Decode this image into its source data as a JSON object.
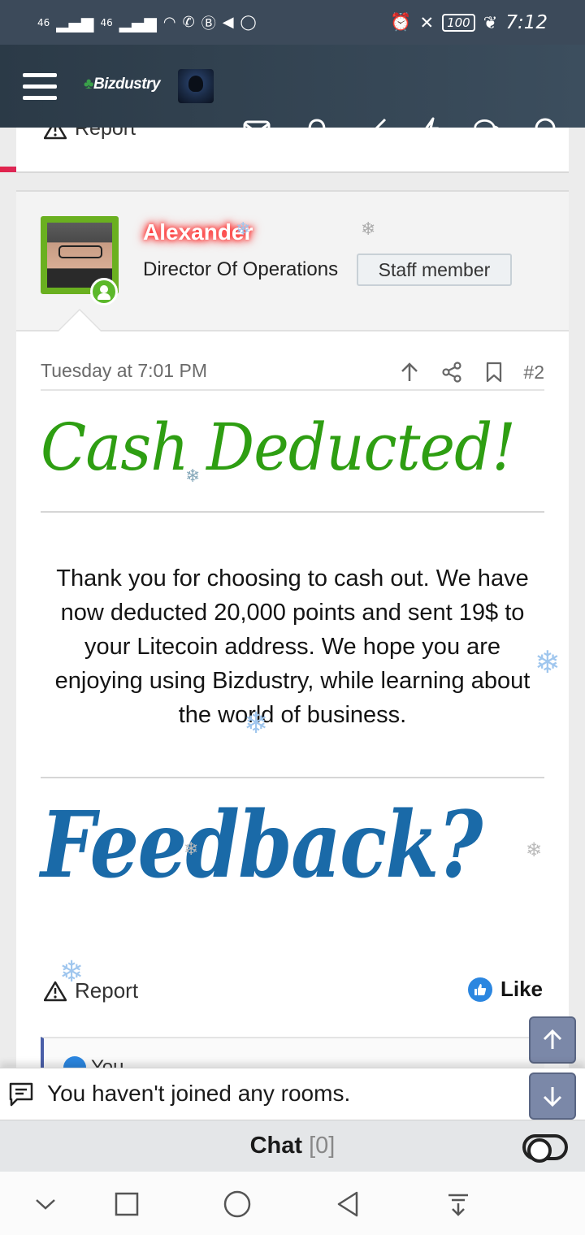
{
  "status_bar": {
    "signal_left": "46",
    "signal_right": "46",
    "battery": "100",
    "time": "7:12"
  },
  "app_bar": {
    "logo_text": "Bizdustry"
  },
  "previous_post": {
    "report_label": "Report"
  },
  "post": {
    "author": "Alexander",
    "user_title": "Director Of Operations",
    "badge": "Staff member",
    "date": "Tuesday at 7:01 PM",
    "number": "#2",
    "heading_image_text": "Cash Deducted!",
    "body": "Thank you for choosing to cash out. We have now deducted 20,000 points and sent 19$ to your Litecoin address. We hope you are enjoying using Bizdustry, while learning about the world of business.",
    "feedback_image_text": "Feedback?",
    "report_label": "Report",
    "like_label": "Like",
    "reaction_preview": "You"
  },
  "chat": {
    "message": "You haven't joined any rooms.",
    "label": "Chat",
    "count": "[0]"
  },
  "colors": {
    "appbar": "#2b3a47",
    "username_glow": "#ff2a2a",
    "cash_green": "#2e9e12",
    "feedback_blue": "#1a6aa8",
    "like_blue": "#2b86e0"
  }
}
